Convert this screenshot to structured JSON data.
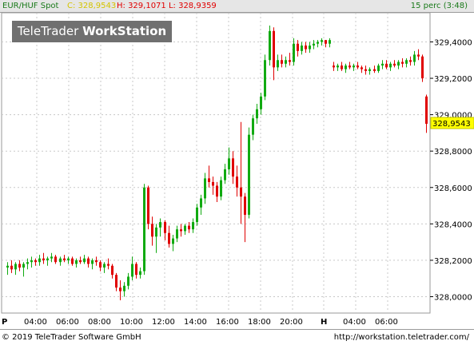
{
  "header": {
    "symbol": "EUR/HUF Spot",
    "close": "C: 328,9543",
    "high_low": "H: 329,1071  L: 328,9359",
    "interval": "15 perc (3:48)"
  },
  "logo": {
    "part1": "TeleTrader ",
    "part2": "WorkStation"
  },
  "footer": {
    "copyright": "© 2019 TeleTrader Software GmbH",
    "url": "http://workstation.teletrader.com/"
  },
  "colors": {
    "up": "#11aa11",
    "down": "#e00000",
    "grid": "#c8c8c8",
    "last_price_bg": "#ffff00"
  },
  "chart_data": {
    "type": "candlestick",
    "instrument": "EUR/HUF Spot",
    "interval": "15 perc",
    "y_ticks": [
      {
        "value": 328.0,
        "label": "328,0000"
      },
      {
        "value": 328.2,
        "label": "328,2000"
      },
      {
        "value": 328.4,
        "label": "328,4000"
      },
      {
        "value": 328.6,
        "label": "328,6000"
      },
      {
        "value": 328.8,
        "label": "328,8000"
      },
      {
        "value": 329.0,
        "label": "329,0000"
      },
      {
        "value": 329.2,
        "label": "329,2000"
      },
      {
        "value": 329.4,
        "label": "329,4000"
      }
    ],
    "ylim": [
      327.91,
      329.56
    ],
    "x_labels": [
      "P",
      "04:00",
      "06:00",
      "08:00",
      "10:00",
      "12:00",
      "14:00",
      "16:00",
      "18:00",
      "20:00",
      "H",
      "04:00",
      "06:00"
    ],
    "last_price": {
      "value": 328.9543,
      "label": "328,9543"
    },
    "grid": true,
    "candles": [
      {
        "o": 328.16,
        "h": 328.19,
        "l": 328.12,
        "c": 328.17
      },
      {
        "o": 328.17,
        "h": 328.2,
        "l": 328.13,
        "c": 328.15
      },
      {
        "o": 328.15,
        "h": 328.19,
        "l": 328.12,
        "c": 328.18
      },
      {
        "o": 328.18,
        "h": 328.2,
        "l": 328.14,
        "c": 328.16
      },
      {
        "o": 328.16,
        "h": 328.19,
        "l": 328.11,
        "c": 328.18
      },
      {
        "o": 328.18,
        "h": 328.21,
        "l": 328.15,
        "c": 328.19
      },
      {
        "o": 328.19,
        "h": 328.22,
        "l": 328.16,
        "c": 328.2
      },
      {
        "o": 328.2,
        "h": 328.21,
        "l": 328.17,
        "c": 328.19
      },
      {
        "o": 328.19,
        "h": 328.23,
        "l": 328.17,
        "c": 328.21
      },
      {
        "o": 328.21,
        "h": 328.24,
        "l": 328.18,
        "c": 328.2
      },
      {
        "o": 328.2,
        "h": 328.22,
        "l": 328.17,
        "c": 328.21
      },
      {
        "o": 328.21,
        "h": 328.24,
        "l": 328.19,
        "c": 328.22
      },
      {
        "o": 328.22,
        "h": 328.23,
        "l": 328.18,
        "c": 328.19
      },
      {
        "o": 328.19,
        "h": 328.22,
        "l": 328.17,
        "c": 328.21
      },
      {
        "o": 328.21,
        "h": 328.23,
        "l": 328.19,
        "c": 328.2
      },
      {
        "o": 328.2,
        "h": 328.22,
        "l": 328.18,
        "c": 328.21
      },
      {
        "o": 328.21,
        "h": 328.22,
        "l": 328.17,
        "c": 328.18
      },
      {
        "o": 328.18,
        "h": 328.21,
        "l": 328.16,
        "c": 328.2
      },
      {
        "o": 328.2,
        "h": 328.22,
        "l": 328.18,
        "c": 328.19
      },
      {
        "o": 328.19,
        "h": 328.23,
        "l": 328.18,
        "c": 328.21
      },
      {
        "o": 328.21,
        "h": 328.22,
        "l": 328.16,
        "c": 328.18
      },
      {
        "o": 328.18,
        "h": 328.21,
        "l": 328.15,
        "c": 328.2
      },
      {
        "o": 328.2,
        "h": 328.22,
        "l": 328.17,
        "c": 328.19
      },
      {
        "o": 328.19,
        "h": 328.2,
        "l": 328.14,
        "c": 328.16
      },
      {
        "o": 328.16,
        "h": 328.19,
        "l": 328.13,
        "c": 328.18
      },
      {
        "o": 328.18,
        "h": 328.21,
        "l": 328.15,
        "c": 328.17
      },
      {
        "o": 328.17,
        "h": 328.18,
        "l": 328.1,
        "c": 328.12
      },
      {
        "o": 328.12,
        "h": 328.13,
        "l": 328.03,
        "c": 328.05
      },
      {
        "o": 328.05,
        "h": 328.09,
        "l": 327.98,
        "c": 328.03
      },
      {
        "o": 328.03,
        "h": 328.08,
        "l": 328.0,
        "c": 328.06
      },
      {
        "o": 328.06,
        "h": 328.13,
        "l": 328.04,
        "c": 328.11
      },
      {
        "o": 328.11,
        "h": 328.22,
        "l": 328.09,
        "c": 328.18
      },
      {
        "o": 328.18,
        "h": 328.19,
        "l": 328.1,
        "c": 328.12
      },
      {
        "o": 328.12,
        "h": 328.16,
        "l": 328.1,
        "c": 328.14
      },
      {
        "o": 328.14,
        "h": 328.62,
        "l": 328.12,
        "c": 328.6
      },
      {
        "o": 328.6,
        "h": 328.61,
        "l": 328.37,
        "c": 328.4
      },
      {
        "o": 328.4,
        "h": 328.44,
        "l": 328.28,
        "c": 328.33
      },
      {
        "o": 328.33,
        "h": 328.4,
        "l": 328.24,
        "c": 328.38
      },
      {
        "o": 328.38,
        "h": 328.43,
        "l": 328.33,
        "c": 328.41
      },
      {
        "o": 328.41,
        "h": 328.42,
        "l": 328.31,
        "c": 328.35
      },
      {
        "o": 328.35,
        "h": 328.39,
        "l": 328.27,
        "c": 328.29
      },
      {
        "o": 328.29,
        "h": 328.34,
        "l": 328.25,
        "c": 328.32
      },
      {
        "o": 328.32,
        "h": 328.39,
        "l": 328.3,
        "c": 328.37
      },
      {
        "o": 328.37,
        "h": 328.4,
        "l": 328.33,
        "c": 328.36
      },
      {
        "o": 328.36,
        "h": 328.4,
        "l": 328.34,
        "c": 328.39
      },
      {
        "o": 328.39,
        "h": 328.41,
        "l": 328.35,
        "c": 328.37
      },
      {
        "o": 328.37,
        "h": 328.43,
        "l": 328.35,
        "c": 328.41
      },
      {
        "o": 328.41,
        "h": 328.51,
        "l": 328.39,
        "c": 328.49
      },
      {
        "o": 328.49,
        "h": 328.56,
        "l": 328.45,
        "c": 328.54
      },
      {
        "o": 328.54,
        "h": 328.68,
        "l": 328.51,
        "c": 328.65
      },
      {
        "o": 328.65,
        "h": 328.72,
        "l": 328.6,
        "c": 328.63
      },
      {
        "o": 328.63,
        "h": 328.66,
        "l": 328.56,
        "c": 328.61
      },
      {
        "o": 328.61,
        "h": 328.63,
        "l": 328.52,
        "c": 328.55
      },
      {
        "o": 328.55,
        "h": 328.66,
        "l": 328.53,
        "c": 328.64
      },
      {
        "o": 328.64,
        "h": 328.73,
        "l": 328.62,
        "c": 328.7
      },
      {
        "o": 328.7,
        "h": 328.82,
        "l": 328.67,
        "c": 328.76
      },
      {
        "o": 328.76,
        "h": 328.8,
        "l": 328.62,
        "c": 328.66
      },
      {
        "o": 328.66,
        "h": 328.72,
        "l": 328.55,
        "c": 328.6
      },
      {
        "o": 328.6,
        "h": 328.96,
        "l": 328.4,
        "c": 328.55
      },
      {
        "o": 328.55,
        "h": 328.57,
        "l": 328.3,
        "c": 328.45
      },
      {
        "o": 328.45,
        "h": 328.93,
        "l": 328.43,
        "c": 328.89
      },
      {
        "o": 328.89,
        "h": 329.0,
        "l": 328.86,
        "c": 328.98
      },
      {
        "o": 328.98,
        "h": 329.06,
        "l": 328.95,
        "c": 329.03
      },
      {
        "o": 329.03,
        "h": 329.12,
        "l": 329.0,
        "c": 329.1
      },
      {
        "o": 329.1,
        "h": 329.33,
        "l": 329.08,
        "c": 329.3
      },
      {
        "o": 329.3,
        "h": 329.49,
        "l": 329.27,
        "c": 329.46
      },
      {
        "o": 329.46,
        "h": 329.48,
        "l": 329.19,
        "c": 329.26
      },
      {
        "o": 329.26,
        "h": 329.33,
        "l": 329.24,
        "c": 329.3
      },
      {
        "o": 329.3,
        "h": 329.33,
        "l": 329.26,
        "c": 329.28
      },
      {
        "o": 329.28,
        "h": 329.32,
        "l": 329.26,
        "c": 329.3
      },
      {
        "o": 329.3,
        "h": 329.34,
        "l": 329.27,
        "c": 329.29
      },
      {
        "o": 329.29,
        "h": 329.42,
        "l": 329.27,
        "c": 329.39
      },
      {
        "o": 329.39,
        "h": 329.41,
        "l": 329.32,
        "c": 329.35
      },
      {
        "o": 329.35,
        "h": 329.4,
        "l": 329.33,
        "c": 329.38
      },
      {
        "o": 329.38,
        "h": 329.4,
        "l": 329.34,
        "c": 329.36
      },
      {
        "o": 329.36,
        "h": 329.4,
        "l": 329.34,
        "c": 329.38
      },
      {
        "o": 329.38,
        "h": 329.41,
        "l": 329.36,
        "c": 329.39
      },
      {
        "o": 329.39,
        "h": 329.41,
        "l": 329.37,
        "c": 329.4
      },
      {
        "o": 329.4,
        "h": 329.42,
        "l": 329.38,
        "c": 329.41
      },
      {
        "o": 329.41,
        "h": 329.41,
        "l": 329.37,
        "c": 329.39
      },
      {
        "o": 329.39,
        "h": 329.42,
        "l": 329.37,
        "c": 329.41
      },
      {
        "o": 329.27,
        "h": 329.29,
        "l": 329.24,
        "c": 329.26
      },
      {
        "o": 329.26,
        "h": 329.28,
        "l": 329.24,
        "c": 329.27
      },
      {
        "o": 329.27,
        "h": 329.29,
        "l": 329.24,
        "c": 329.25
      },
      {
        "o": 329.25,
        "h": 329.28,
        "l": 329.23,
        "c": 329.27
      },
      {
        "o": 329.27,
        "h": 329.29,
        "l": 329.25,
        "c": 329.26
      },
      {
        "o": 329.26,
        "h": 329.28,
        "l": 329.24,
        "c": 329.27
      },
      {
        "o": 329.27,
        "h": 329.29,
        "l": 329.25,
        "c": 329.26
      },
      {
        "o": 329.26,
        "h": 329.27,
        "l": 329.23,
        "c": 329.25
      },
      {
        "o": 329.25,
        "h": 329.27,
        "l": 329.22,
        "c": 329.24
      },
      {
        "o": 329.24,
        "h": 329.26,
        "l": 329.22,
        "c": 329.25
      },
      {
        "o": 329.25,
        "h": 329.27,
        "l": 329.23,
        "c": 329.24
      },
      {
        "o": 329.24,
        "h": 329.28,
        "l": 329.23,
        "c": 329.27
      },
      {
        "o": 329.27,
        "h": 329.3,
        "l": 329.25,
        "c": 329.28
      },
      {
        "o": 329.28,
        "h": 329.3,
        "l": 329.25,
        "c": 329.26
      },
      {
        "o": 329.26,
        "h": 329.29,
        "l": 329.24,
        "c": 329.28
      },
      {
        "o": 329.28,
        "h": 329.3,
        "l": 329.26,
        "c": 329.27
      },
      {
        "o": 329.27,
        "h": 329.3,
        "l": 329.25,
        "c": 329.29
      },
      {
        "o": 329.29,
        "h": 329.31,
        "l": 329.26,
        "c": 329.28
      },
      {
        "o": 329.28,
        "h": 329.31,
        "l": 329.26,
        "c": 329.3
      },
      {
        "o": 329.3,
        "h": 329.32,
        "l": 329.27,
        "c": 329.29
      },
      {
        "o": 329.29,
        "h": 329.35,
        "l": 329.27,
        "c": 329.33
      },
      {
        "o": 329.33,
        "h": 329.36,
        "l": 329.3,
        "c": 329.32
      },
      {
        "o": 329.32,
        "h": 329.33,
        "l": 329.18,
        "c": 329.2
      },
      {
        "o": 329.1,
        "h": 329.11,
        "l": 328.9,
        "c": 328.95
      }
    ]
  }
}
